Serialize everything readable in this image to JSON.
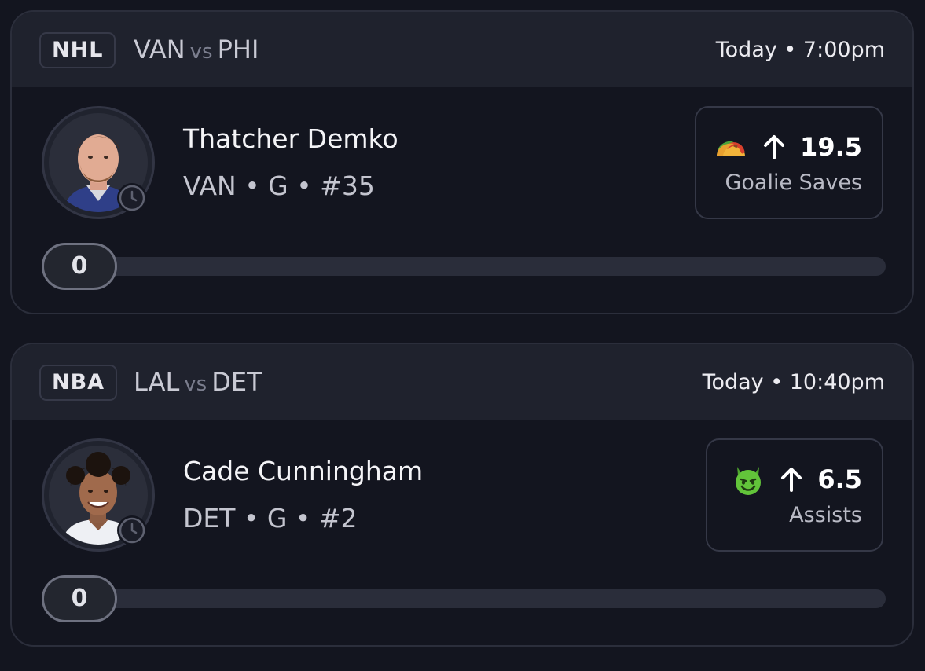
{
  "cards": [
    {
      "league": "NHL",
      "home_team": "VAN",
      "vs_label": "vs",
      "away_team": "PHI",
      "game_time": "Today • 7:00pm",
      "player": {
        "name": "Thatcher Demko",
        "meta": "VAN • G • #35"
      },
      "prop": {
        "emoji_icon": "taco-emoji-icon",
        "direction_icon": "arrow-up-icon",
        "line": "19.5",
        "stat": "Goalie Saves"
      },
      "progress": {
        "value": "0",
        "fraction": 0
      }
    },
    {
      "league": "NBA",
      "home_team": "LAL",
      "vs_label": "vs",
      "away_team": "DET",
      "game_time": "Today • 10:40pm",
      "player": {
        "name": "Cade Cunningham",
        "meta": "DET • G • #2"
      },
      "prop": {
        "emoji_icon": "green-devil-emoji-icon",
        "direction_icon": "arrow-up-icon",
        "line": "6.5",
        "stat": "Assists"
      },
      "progress": {
        "value": "0",
        "fraction": 0
      }
    }
  ],
  "colors": {
    "background": "#13151f",
    "header": "#1f222d",
    "border": "#2b2e3b",
    "track": "#2a2d3a",
    "accent_green": "#62c43a"
  }
}
